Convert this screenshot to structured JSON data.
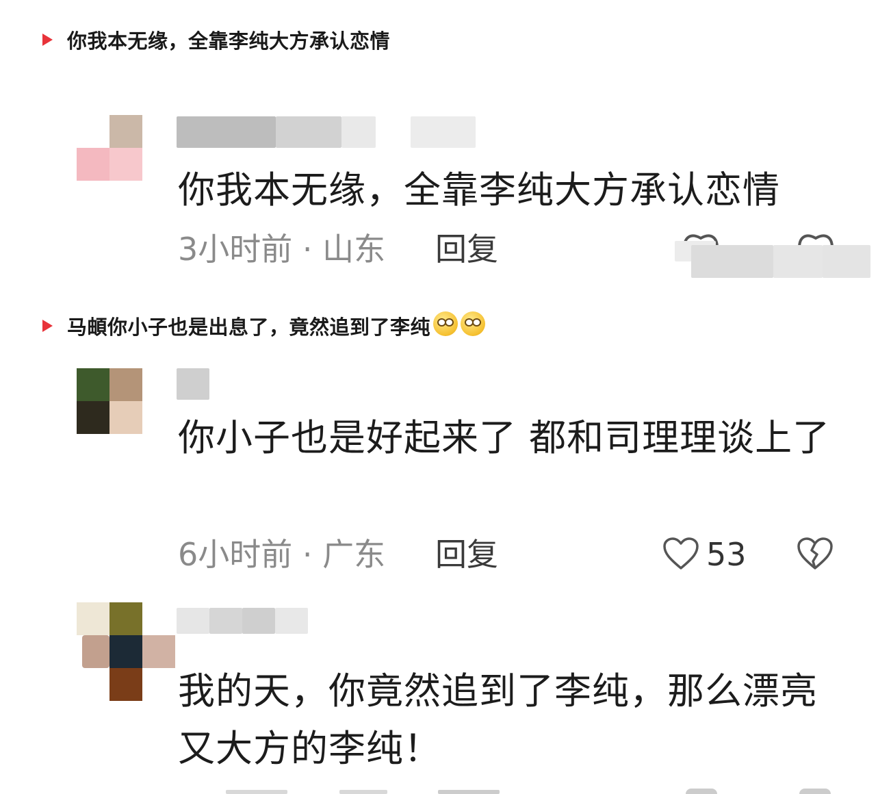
{
  "captions": [
    {
      "text": "你我本无缘，全靠李纯大方承认恋情"
    },
    {
      "text": "马頔你小子也是出息了，竟然追到了李纯",
      "emoji_count": 2,
      "emoji_icon": "pleading-face-icon"
    }
  ],
  "comments": [
    {
      "text": "你我本无缘，全靠李纯大方承认恋情",
      "time_location": "3小时前 · 山东",
      "reply_label": "回复"
    },
    {
      "text": "你小子也是好起来了 都和司理理谈上了",
      "time_location": "6小时前 · 广东",
      "reply_label": "回复",
      "like_count": "53"
    },
    {
      "text": "我的天，你竟然追到了李纯，那么漂亮又大方的李纯！"
    }
  ],
  "colors": {
    "caption_marker": "#e8333a",
    "meta_text": "#8a8a8a",
    "body_text": "#1c1c1c"
  }
}
